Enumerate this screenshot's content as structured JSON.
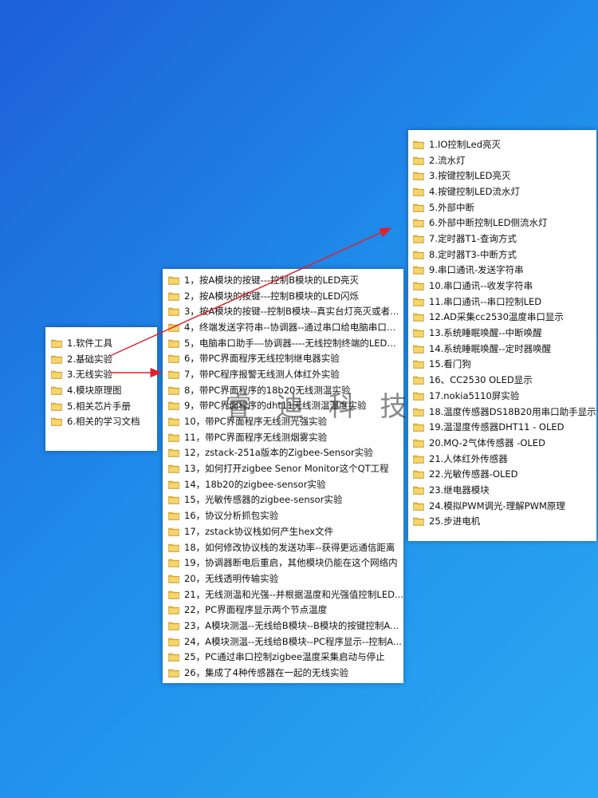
{
  "colors": {
    "arrow": "#e0202a",
    "folder_body": "#e8b93a",
    "folder_tab": "#f6d66b"
  },
  "left_panel": {
    "items": [
      "1.软件工具",
      "2.基础实验",
      "3.无线实验",
      "4.模块原理图",
      "5.相关芯片手册",
      "6.相关的学习文档"
    ]
  },
  "middle_panel": {
    "items": [
      "1，按A模块的按键---控制B模块的LED亮灭",
      "2，按A模块的按键---控制B模块的LED闪烁",
      "3，按A模块的按键--控制B模块--真实台灯亮灭或者...",
      "4，终端发送字符串--协调器--通过串口给电脑串口助...",
      "5，电脑串口助手---协调器----无线控制终端的LED亮...",
      "6，带PC界面程序无线控制继电器实验",
      "7，带PC程序报警无线测人体红外实验",
      "8，带PC界面程序的18b20无线测温实验",
      "9，带PC界面程序的dht11无线测温湿度实验",
      "10，带PC界面程序无线测光强实验",
      "11，带PC界面程序无线测烟雾实验",
      "12，zstack-251a版本的Zigbee-Sensor实验",
      "13，如何打开zigbee Senor Monitor这个QT工程",
      "14，18b20的zigbee-sensor实验",
      "15，光敏传感器的zigbee-sensor实验",
      "16，协议分析抓包实验",
      "17，zstack协议栈如何产生hex文件",
      "18，如何修改协议栈的发送功率--获得更远通信距离",
      "19，协调器断电后重启，其他模块仍能在这个网络内",
      "20，无线透明传输实验",
      "21，无线测温和光强--并根据温度和光强值控制LED...",
      "22，PC界面程序显示两个节点温度",
      "23，A模块测温--无线给B模块--B模块的按键控制A...",
      "24，A模块测温--无线给B模块--PC程序显示--控制A...",
      "25，PC通过串口控制zigbee温度采集启动与停止",
      "26，集成了4种传感器在一起的无线实验"
    ]
  },
  "right_panel": {
    "items": [
      "1.IO控制Led亮灭",
      "2.流水灯",
      "3.按键控制LED亮灭",
      "4.按键控制LED流水灯",
      "5.外部中断",
      "6.外部中断控制LED侧流水灯",
      "7.定时器T1-查询方式",
      "8.定时器T3-中断方式",
      "9.串口通讯-发送字符串",
      "10.串口通讯--收发字符串",
      "11.串口通讯--串口控制LED",
      "12.AD采集cc2530温度串口显示",
      "13.系统睡眠唤醒--中断唤醒",
      "14.系统睡眠唤醒--定时器唤醒",
      "15.看门狗",
      "16、CC2530 OLED显示",
      "17.nokia5110屏实验",
      "18.温度传感器DS18B20用串口助手显示",
      "19.温湿度传感器DHT11 - OLED",
      "20.MQ-2气体传感器 -OLED",
      "21.人体红外传感器",
      "22.光敏传感器-OLED",
      "23.继电器模块",
      "24.模拟PWM调光-理解PWM原理",
      "25.步进电机"
    ]
  },
  "watermark": {
    "text": "睿 迪 科 技"
  }
}
